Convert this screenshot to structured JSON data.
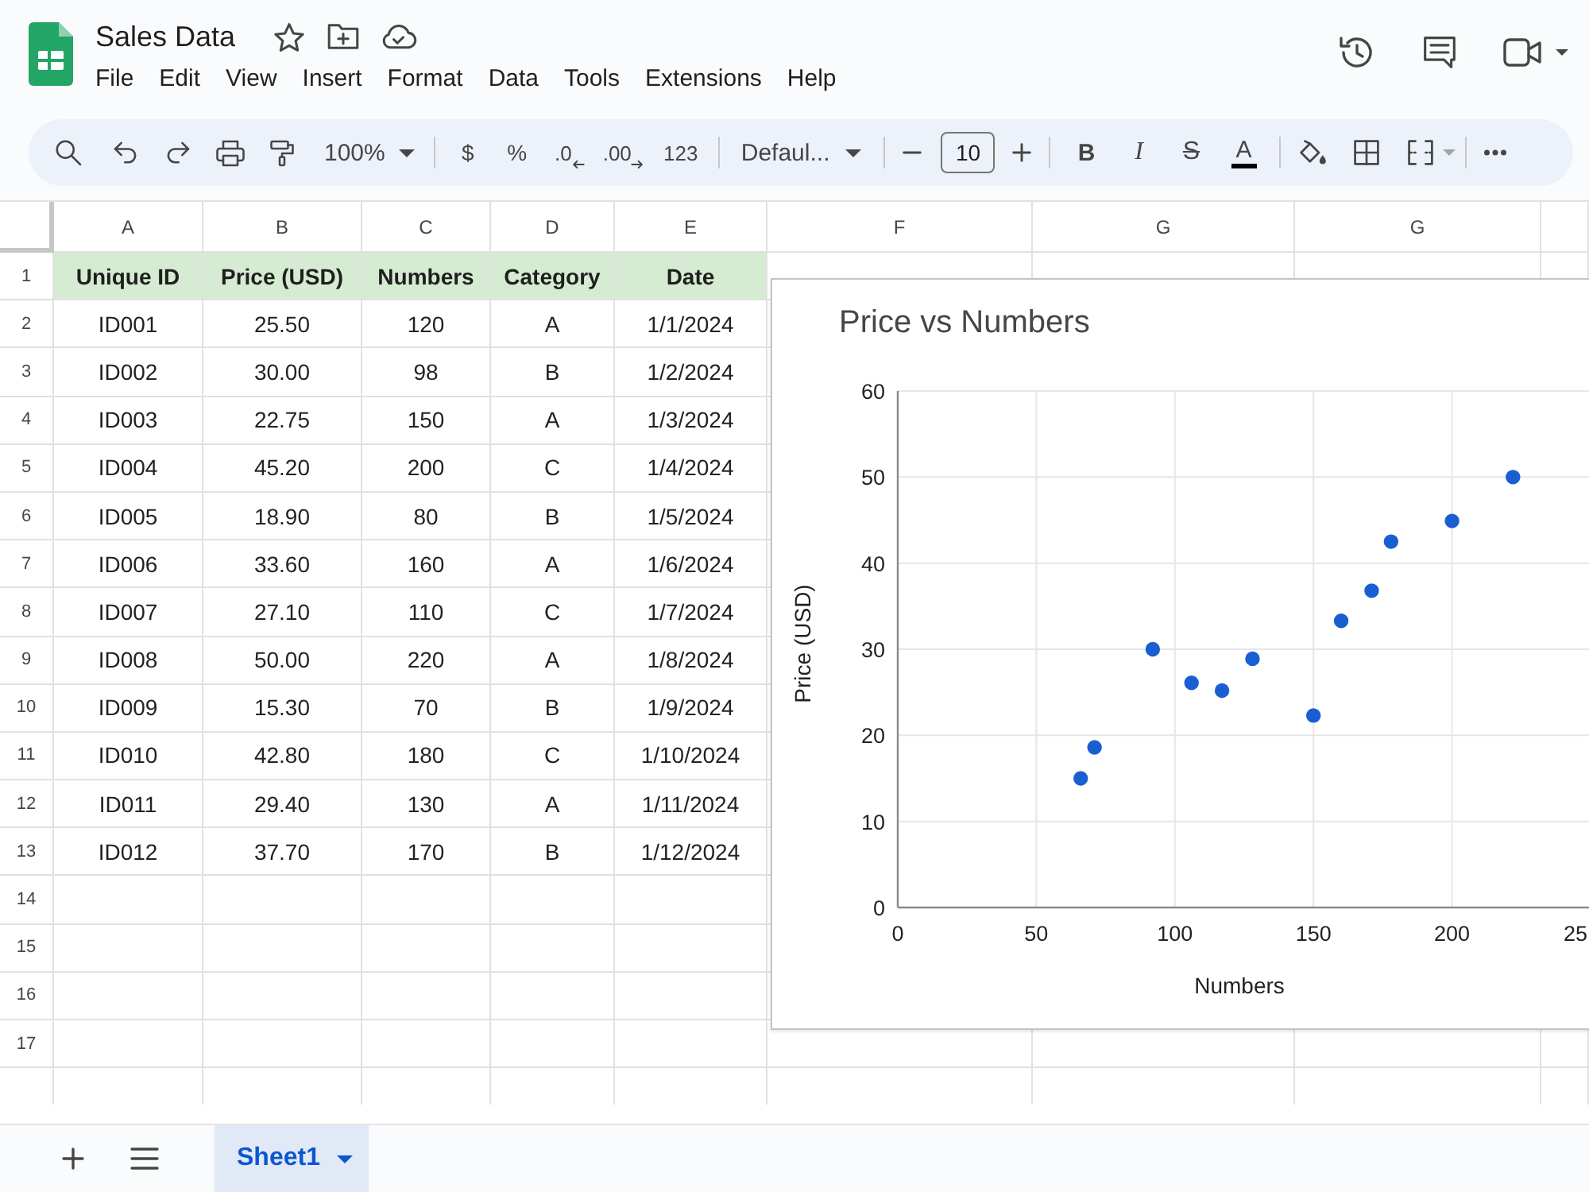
{
  "app": {
    "title": "Sales Data",
    "menu": [
      "File",
      "Edit",
      "View",
      "Insert",
      "Format",
      "Data",
      "Tools",
      "Extensions",
      "Help"
    ]
  },
  "toolbar": {
    "zoom": "100%",
    "currency": "$",
    "percent": "%",
    "decrease_decimal": ".0",
    "increase_decimal": ".00",
    "number_format": "123",
    "font": "Defaul...",
    "font_size": "10",
    "bold": "B",
    "italic": "I",
    "strikethrough": "S",
    "text_color": "A"
  },
  "sheet": {
    "column_letters": [
      "A",
      "B",
      "C",
      "D",
      "E",
      "F",
      "G",
      "G"
    ],
    "row_numbers": [
      "1",
      "2",
      "3",
      "4",
      "5",
      "6",
      "7",
      "8",
      "9",
      "10",
      "11",
      "12",
      "13",
      "14",
      "15",
      "16",
      "17"
    ],
    "header_cells": [
      "Unique ID",
      "Price (USD)",
      "Numbers",
      "Category",
      "Date"
    ],
    "data_rows": [
      [
        "ID001",
        "25.50",
        "120",
        "A",
        "1/1/2024"
      ],
      [
        "ID002",
        "30.00",
        "98",
        "B",
        "1/2/2024"
      ],
      [
        "ID003",
        "22.75",
        "150",
        "A",
        "1/3/2024"
      ],
      [
        "ID004",
        "45.20",
        "200",
        "C",
        "1/4/2024"
      ],
      [
        "ID005",
        "18.90",
        "80",
        "B",
        "1/5/2024"
      ],
      [
        "ID006",
        "33.60",
        "160",
        "A",
        "1/6/2024"
      ],
      [
        "ID007",
        "27.10",
        "110",
        "C",
        "1/7/2024"
      ],
      [
        "ID008",
        "50.00",
        "220",
        "A",
        "1/8/2024"
      ],
      [
        "ID009",
        "15.30",
        "70",
        "B",
        "1/9/2024"
      ],
      [
        "ID010",
        "42.80",
        "180",
        "C",
        "1/10/2024"
      ],
      [
        "ID011",
        "29.40",
        "130",
        "A",
        "1/11/2024"
      ],
      [
        "ID012",
        "37.70",
        "170",
        "B",
        "1/12/2024"
      ]
    ]
  },
  "chart": {
    "chart_data": {
      "type": "scatter",
      "title": "Price vs Numbers",
      "xlabel": "Numbers",
      "ylabel": "Price (USD)",
      "x": [
        66,
        71,
        92,
        106,
        117,
        128,
        150,
        160,
        171,
        178,
        200,
        222
      ],
      "values": [
        15,
        18.6,
        30,
        26.1,
        25.2,
        28.9,
        22.3,
        33.3,
        36.8,
        42.5,
        44.9,
        50
      ],
      "xlim": [
        0,
        250
      ],
      "ylim": [
        0,
        60
      ],
      "xticks": [
        0,
        50,
        100,
        150,
        200
      ],
      "yticks": [
        0,
        10,
        20,
        30,
        40,
        50,
        60
      ],
      "grid": true
    },
    "edge_tick_label": "25"
  },
  "sheet_tabs": [
    {
      "label": "Sheet1",
      "selected": true
    }
  ]
}
